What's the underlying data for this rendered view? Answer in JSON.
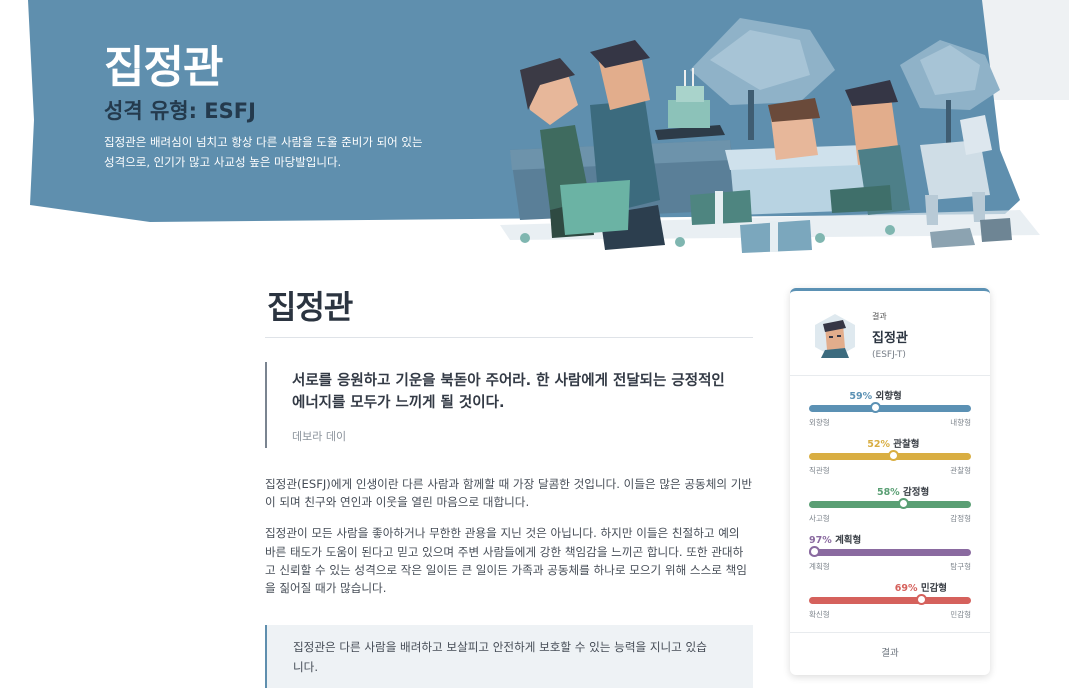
{
  "hero": {
    "title": "집정관",
    "subtitle": "성격 유형: ESFJ",
    "description": "집정관은 배려심이 넘치고 항상 다른 사람을 도울 준비가 되어 있는 성격으로, 인기가 많고 사교성 높은 마당발입니다.",
    "background_color": "#5f8fae"
  },
  "main": {
    "title": "집정관",
    "quote": {
      "text": "서로를 응원하고 기운을 북돋아 주어라. 한 사람에게 전달되는 긍정적인 에너지를 모두가 느끼게 될 것이다.",
      "author": "데보라 데이"
    },
    "paragraphs": [
      "집정관(ESFJ)에게 인생이란 다른 사람과 함께할 때 가장 달콤한 것입니다. 이들은 많은 공동체의 기반이 되며 친구와 연인과 이웃을 열린 마음으로 대합니다.",
      "집정관이 모든 사람을 좋아하거나 무한한 관용을 지닌 것은 아닙니다. 하지만 이들은 친절하고 예의 바른 태도가 도움이 된다고 믿고 있으며 주변 사람들에게 강한 책임감을 느끼곤 합니다. 또한 관대하고 신뢰할 수 있는 성격으로 작은 일이든 큰 일이든 가족과 공동체를 하나로 모으기 위해 스스로 책임을 짊어질 때가 많습니다."
    ],
    "callout": "집정관은 다른 사람을 배려하고 보살피고 안전하게 보호할 수 있는 능력을 지니고 있습니다."
  },
  "card": {
    "label": "결과",
    "type_name": "집정관",
    "type_code": "(ESFJ-T)",
    "traits": [
      {
        "percent": "59%",
        "label": "외향형",
        "left": "외향형",
        "right": "내향형",
        "value": 0.59,
        "side": "left",
        "color": "#5b91b4"
      },
      {
        "percent": "52%",
        "label": "관찰형",
        "left": "직관형",
        "right": "관찰형",
        "value": 0.52,
        "side": "right",
        "color": "#d9ae42"
      },
      {
        "percent": "58%",
        "label": "감정형",
        "left": "사고형",
        "right": "감정형",
        "value": 0.58,
        "side": "right",
        "color": "#5a9f74"
      },
      {
        "percent": "97%",
        "label": "계획형",
        "left": "계획형",
        "right": "탐구형",
        "value": 0.97,
        "side": "left",
        "color": "#8a6aa0"
      },
      {
        "percent": "69%",
        "label": "민감형",
        "left": "확신형",
        "right": "민감형",
        "value": 0.69,
        "side": "right",
        "color": "#d5615c"
      }
    ],
    "footer": "결과"
  }
}
